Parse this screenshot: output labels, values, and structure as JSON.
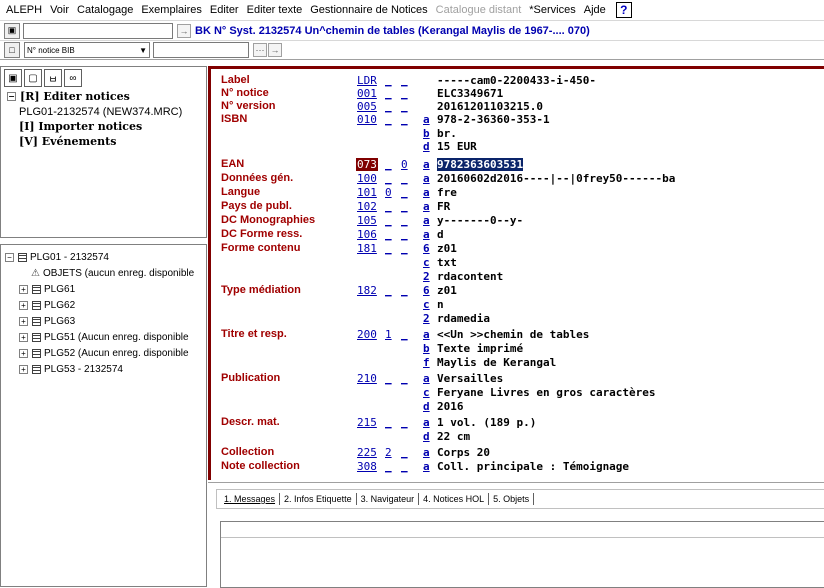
{
  "menu": [
    "ALEPH",
    "Voir",
    "Catalogage",
    "Exemplaires",
    "Editer",
    "Editer texte",
    "Gestionnaire de Notices",
    "Catalogue distant",
    "*Services",
    "Ajde"
  ],
  "menu_disabled_index": 7,
  "help_label": "?",
  "toolbar": {
    "record_title": "BK N° Syst. 2132574 Un^chemin de tables (Kerangal Maylis de 1967-.... 070)",
    "search_type": "N° notice BIB"
  },
  "tree": {
    "items": [
      {
        "pm": "−",
        "label": "[R] Editer notices",
        "bold": true,
        "indent": 0
      },
      {
        "pm": "",
        "label": "PLG01-2132574 (NEW374.MRC)",
        "bold": false,
        "indent": 1
      },
      {
        "pm": "",
        "label": "[I] Importer notices",
        "bold": true,
        "indent": 0
      },
      {
        "pm": "",
        "label": "[V] Evénements",
        "bold": true,
        "indent": 0
      }
    ]
  },
  "libs": {
    "root": "PLG01 - 2132574",
    "objects": "OBJETS (aucun enreg. disponible",
    "items": [
      "PLG61",
      "PLG62",
      "PLG63",
      "PLG51 (Aucun enreg. disponible",
      "PLG52 (Aucun enreg. disponible",
      "PLG53 - 2132574"
    ]
  },
  "record": [
    {
      "label": "Label",
      "tag": "LDR",
      "i1": "_",
      "i2": "_",
      "sub": "",
      "value": "-----cam0-2200433-i-450-"
    },
    {
      "label": "N° notice",
      "tag": "001",
      "i1": "_",
      "i2": "_",
      "sub": "",
      "value": "ELC3349671"
    },
    {
      "label": "N° version",
      "tag": "005",
      "i1": "_",
      "i2": "_",
      "sub": "",
      "value": "20161201103215.0"
    },
    {
      "label": "ISBN",
      "tag": "010",
      "i1": "_",
      "i2": "_",
      "sub": "a",
      "value": "978-2-36360-353-1"
    },
    {
      "label": "",
      "tag": "",
      "i1": "",
      "i2": "",
      "sub": "b",
      "value": "br."
    },
    {
      "label": "",
      "tag": "",
      "i1": "",
      "i2": "",
      "sub": "d",
      "value": "15 EUR"
    },
    {
      "label": "EAN",
      "tag": "073",
      "i1": "_",
      "i2": "0",
      "sub": "a",
      "value": "9782363603531",
      "hl": true
    },
    {
      "label": "Données gén.",
      "tag": "100",
      "i1": "_",
      "i2": "_",
      "sub": "a",
      "value": "20160602d2016----|--|0frey50------ba"
    },
    {
      "label": "Langue",
      "tag": "101",
      "i1": "0",
      "i2": "_",
      "sub": "a",
      "value": "fre"
    },
    {
      "label": "Pays de publ.",
      "tag": "102",
      "i1": "_",
      "i2": "_",
      "sub": "a",
      "value": "FR"
    },
    {
      "label": "DC Monographies",
      "tag": "105",
      "i1": "_",
      "i2": "_",
      "sub": "a",
      "value": "y-------0--y-"
    },
    {
      "label": "DC Forme ress.",
      "tag": "106",
      "i1": "_",
      "i2": "_",
      "sub": "a",
      "value": "d"
    },
    {
      "label": "Forme contenu",
      "tag": "181",
      "i1": "_",
      "i2": "_",
      "sub": "6",
      "value": "z01"
    },
    {
      "label": "",
      "tag": "",
      "i1": "",
      "i2": "",
      "sub": "c",
      "value": "txt"
    },
    {
      "label": "",
      "tag": "",
      "i1": "",
      "i2": "",
      "sub": "2",
      "value": "rdacontent"
    },
    {
      "label": "Type médiation",
      "tag": "182",
      "i1": "_",
      "i2": "_",
      "sub": "6",
      "value": "z01"
    },
    {
      "label": "",
      "tag": "",
      "i1": "",
      "i2": "",
      "sub": "c",
      "value": "n"
    },
    {
      "label": "",
      "tag": "",
      "i1": "",
      "i2": "",
      "sub": "2",
      "value": "rdamedia"
    },
    {
      "label": "Titre et resp.",
      "tag": "200",
      "i1": "1",
      "i2": "_",
      "sub": "a",
      "value": "<<Un >>chemin de tables"
    },
    {
      "label": "",
      "tag": "",
      "i1": "",
      "i2": "",
      "sub": "b",
      "value": "Texte imprimé"
    },
    {
      "label": "",
      "tag": "",
      "i1": "",
      "i2": "",
      "sub": "f",
      "value": "Maylis de Kerangal"
    },
    {
      "label": "Publication",
      "tag": "210",
      "i1": "_",
      "i2": "_",
      "sub": "a",
      "value": "Versailles"
    },
    {
      "label": "",
      "tag": "",
      "i1": "",
      "i2": "",
      "sub": "c",
      "value": "Feryane Livres en gros caractères"
    },
    {
      "label": "",
      "tag": "",
      "i1": "",
      "i2": "",
      "sub": "d",
      "value": "2016"
    },
    {
      "label": "Descr. mat.",
      "tag": "215",
      "i1": "_",
      "i2": "_",
      "sub": "a",
      "value": "1 vol. (189 p.)"
    },
    {
      "label": "",
      "tag": "",
      "i1": "",
      "i2": "",
      "sub": "d",
      "value": "22 cm"
    },
    {
      "label": "Collection",
      "tag": "225",
      "i1": "2",
      "i2": "_",
      "sub": "a",
      "value": "Corps 20"
    },
    {
      "label": "Note collection",
      "tag": "308",
      "i1": "_",
      "i2": "_",
      "sub": "a",
      "value": "Coll. principale : Témoignage"
    }
  ],
  "tabs": [
    "1. Messages",
    "2. Infos Etiquette",
    "3. Navigateur",
    "4. Notices HOL",
    "5. Objets"
  ]
}
